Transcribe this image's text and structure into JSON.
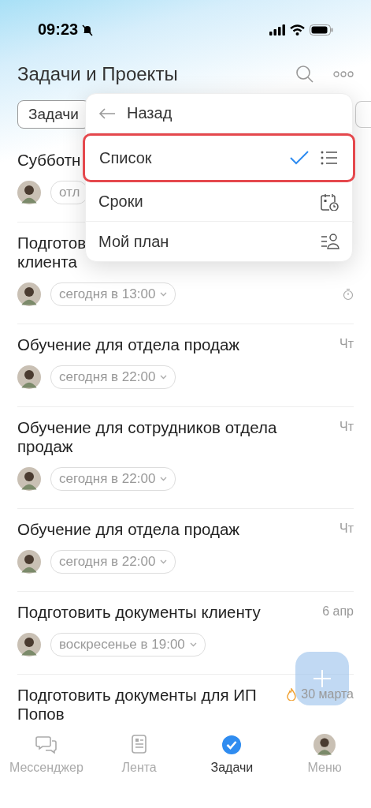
{
  "status_bar": {
    "time": "09:23",
    "muted": true
  },
  "header": {
    "title": "Задачи и Проекты"
  },
  "filters": [
    {
      "label": "Задачи",
      "selected": true
    }
  ],
  "tasks": [
    {
      "title": "Субботн",
      "date": "отл",
      "chevron": false,
      "right": {
        "kind": "none"
      }
    },
    {
      "title": "Подготов\nклиента",
      "date": "сегодня в 13:00",
      "right": {
        "kind": "timer"
      }
    },
    {
      "title": "Обучение для отдела продаж",
      "date": "сегодня в 22:00",
      "right": {
        "kind": "text",
        "text": "Чт"
      }
    },
    {
      "title": "Обучение для сотрудников отдела продаж",
      "date": "сегодня в 22:00",
      "right": {
        "kind": "text",
        "text": "Чт"
      }
    },
    {
      "title": "Обучение для отдела продаж",
      "date": "сегодня в 22:00",
      "right": {
        "kind": "text",
        "text": "Чт"
      }
    },
    {
      "title": "Подготовить документы клиенту",
      "date": "воскресенье в 19:00",
      "right": {
        "kind": "text",
        "text": "6 апр"
      }
    },
    {
      "title": "Подготовить документы для ИП Попов",
      "right": {
        "kind": "fire",
        "text": "30 марта"
      }
    }
  ],
  "menu": {
    "back": "Назад",
    "items": [
      {
        "label": "Список",
        "kind": "list",
        "selected": true,
        "highlighted": true
      },
      {
        "label": "Сроки",
        "kind": "deadlines",
        "selected": false,
        "highlighted": false
      },
      {
        "label": "Мой план",
        "kind": "plan",
        "selected": false,
        "highlighted": false
      }
    ]
  },
  "tab_bar": [
    {
      "label": "Мессенджер",
      "kind": "chat",
      "selected": false
    },
    {
      "label": "Лента",
      "kind": "feed",
      "selected": false
    },
    {
      "label": "Задачи",
      "kind": "tasks",
      "selected": true
    },
    {
      "label": "Меню",
      "kind": "avatar",
      "selected": false
    }
  ]
}
